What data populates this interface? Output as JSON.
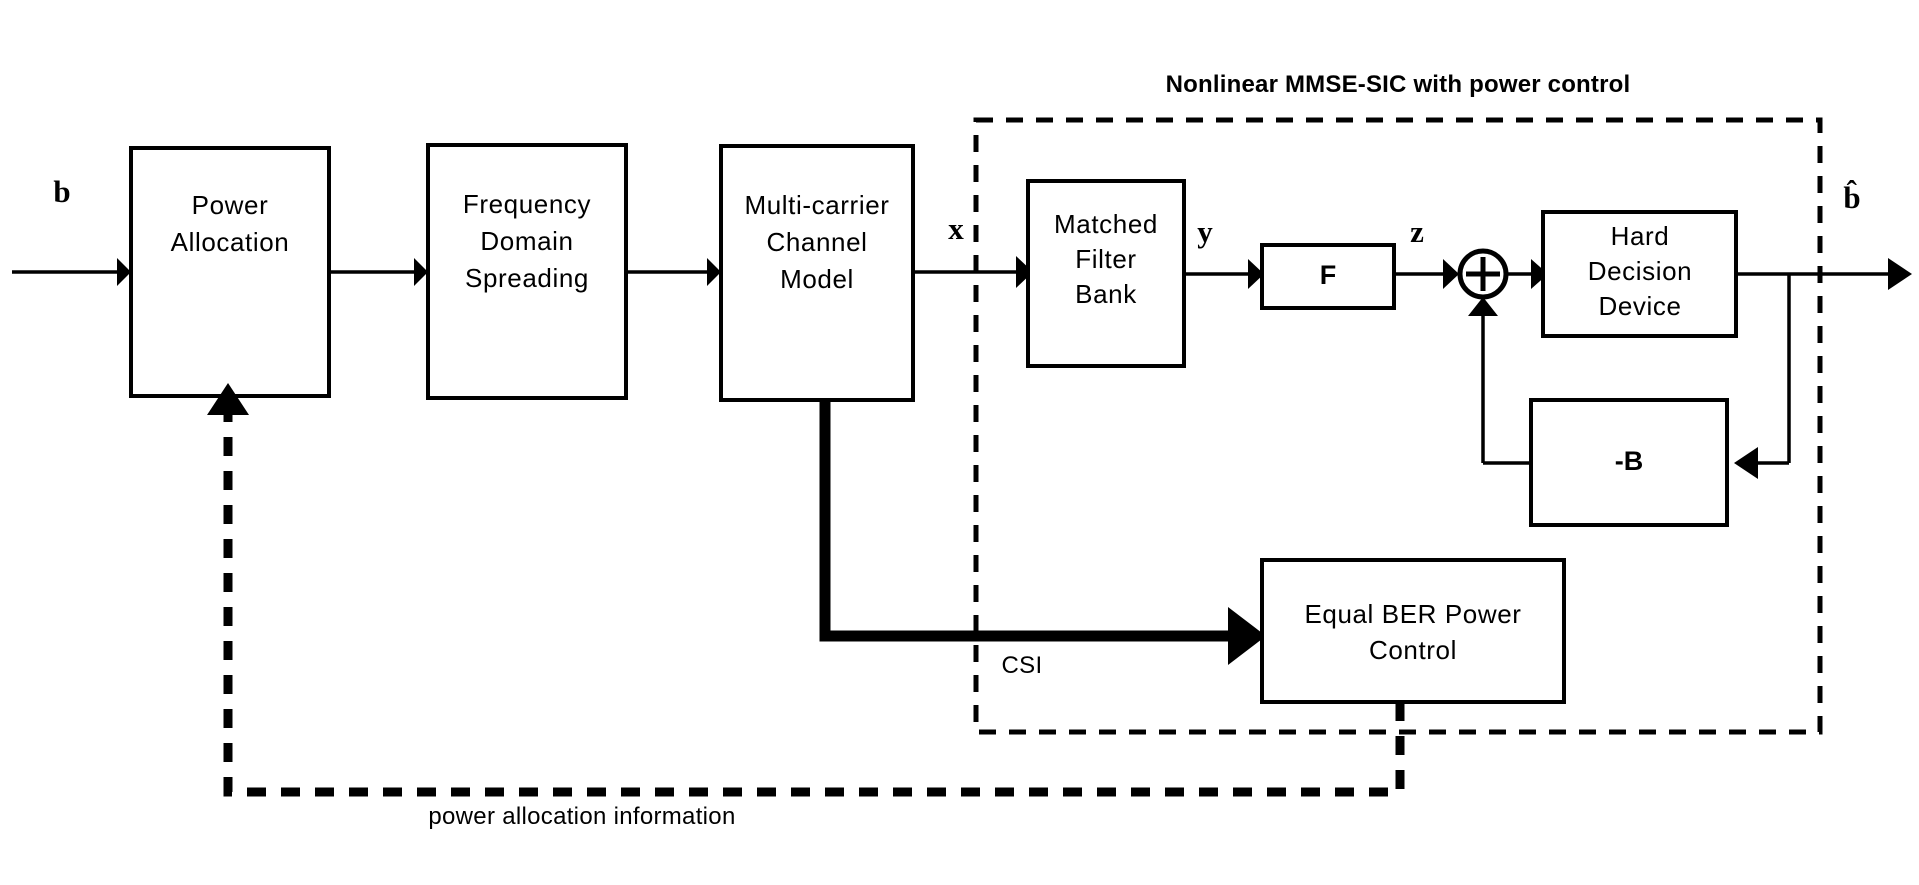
{
  "diagram": {
    "title": "Nonlinear MMSE-SIC with power control",
    "blocks": {
      "power_allocation": "Power\nAllocation",
      "power_allocation_line1": "Power",
      "power_allocation_line2": "Allocation",
      "freq_domain_spreading_line1": "Frequency",
      "freq_domain_spreading_line2": "Domain",
      "freq_domain_spreading_line3": "Spreading",
      "multicarrier_channel_line1": "Multi-carrier",
      "multicarrier_channel_line2": "Channel",
      "multicarrier_channel_line3": "Model",
      "matched_filter_bank_line1": "Matched",
      "matched_filter_bank_line2": "Filter",
      "matched_filter_bank_line3": "Bank",
      "feedforward_filter": "F",
      "hard_decision_line1": "Hard",
      "hard_decision_line2": "Decision",
      "hard_decision_line3": "Device",
      "feedback_filter": "-B",
      "equal_ber_power_control_line1": "Equal BER Power",
      "equal_ber_power_control_line2": "Control"
    },
    "signals": {
      "input_bits": "b",
      "channel_output": "x",
      "mf_output": "y",
      "filter_output": "z",
      "output_bits": "b̂"
    },
    "annotations": {
      "csi": "CSI",
      "power_allocation_information": "power allocation information"
    },
    "colors": {
      "stroke": "#000000",
      "fill": "#ffffff",
      "background": "#ffffff"
    }
  }
}
